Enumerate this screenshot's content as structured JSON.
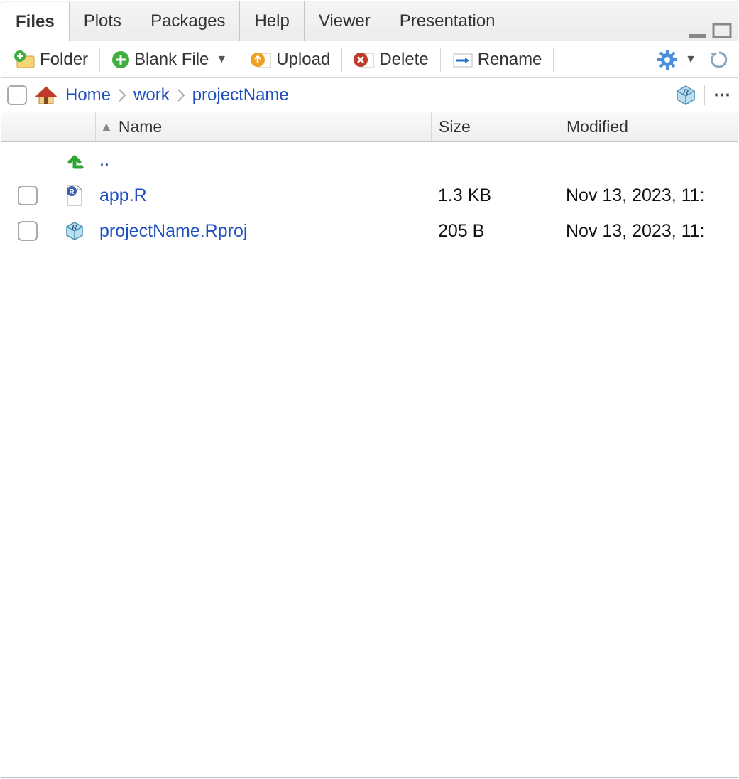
{
  "tabs": {
    "items": [
      "Files",
      "Plots",
      "Packages",
      "Help",
      "Viewer",
      "Presentation"
    ],
    "active_index": 0
  },
  "toolbar": {
    "folder": "Folder",
    "blank_file": "Blank File",
    "upload": "Upload",
    "delete": "Delete",
    "rename": "Rename"
  },
  "breadcrumbs": {
    "items": [
      "Home",
      "work",
      "projectName"
    ]
  },
  "columns": {
    "name": "Name",
    "size": "Size",
    "modified": "Modified"
  },
  "files": {
    "up_label": "..",
    "rows": [
      {
        "name": "app.R",
        "size": "1.3 KB",
        "modified": "Nov 13, 2023, 11:"
      },
      {
        "name": "projectName.Rproj",
        "size": "205 B",
        "modified": "Nov 13, 2023, 11:"
      }
    ]
  }
}
